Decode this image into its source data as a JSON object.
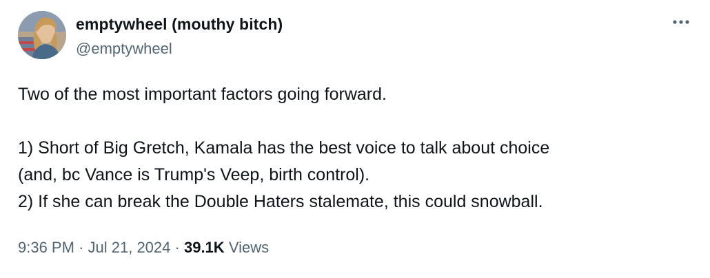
{
  "author": {
    "display_name": "emptywheel (mouthy bitch)",
    "handle": "@emptywheel",
    "avatar_icon": "profile-photo"
  },
  "more_icon": "more-horizontal-icon",
  "tweet": {
    "lines": [
      "Two of the most important factors going forward.",
      "",
      "1) Short of Big Gretch, Kamala has the best voice to talk about choice",
      "(and, bc Vance is Trump's Veep, birth control).",
      "2) If she can break the Double Haters stalemate, this could snowball."
    ]
  },
  "meta": {
    "time": "9:36 PM",
    "separator": "·",
    "date": "Jul 21, 2024",
    "views_count": "39.1K",
    "views_label": "Views"
  },
  "colors": {
    "text_primary": "#0f1419",
    "text_secondary": "#536471",
    "background": "#ffffff"
  }
}
